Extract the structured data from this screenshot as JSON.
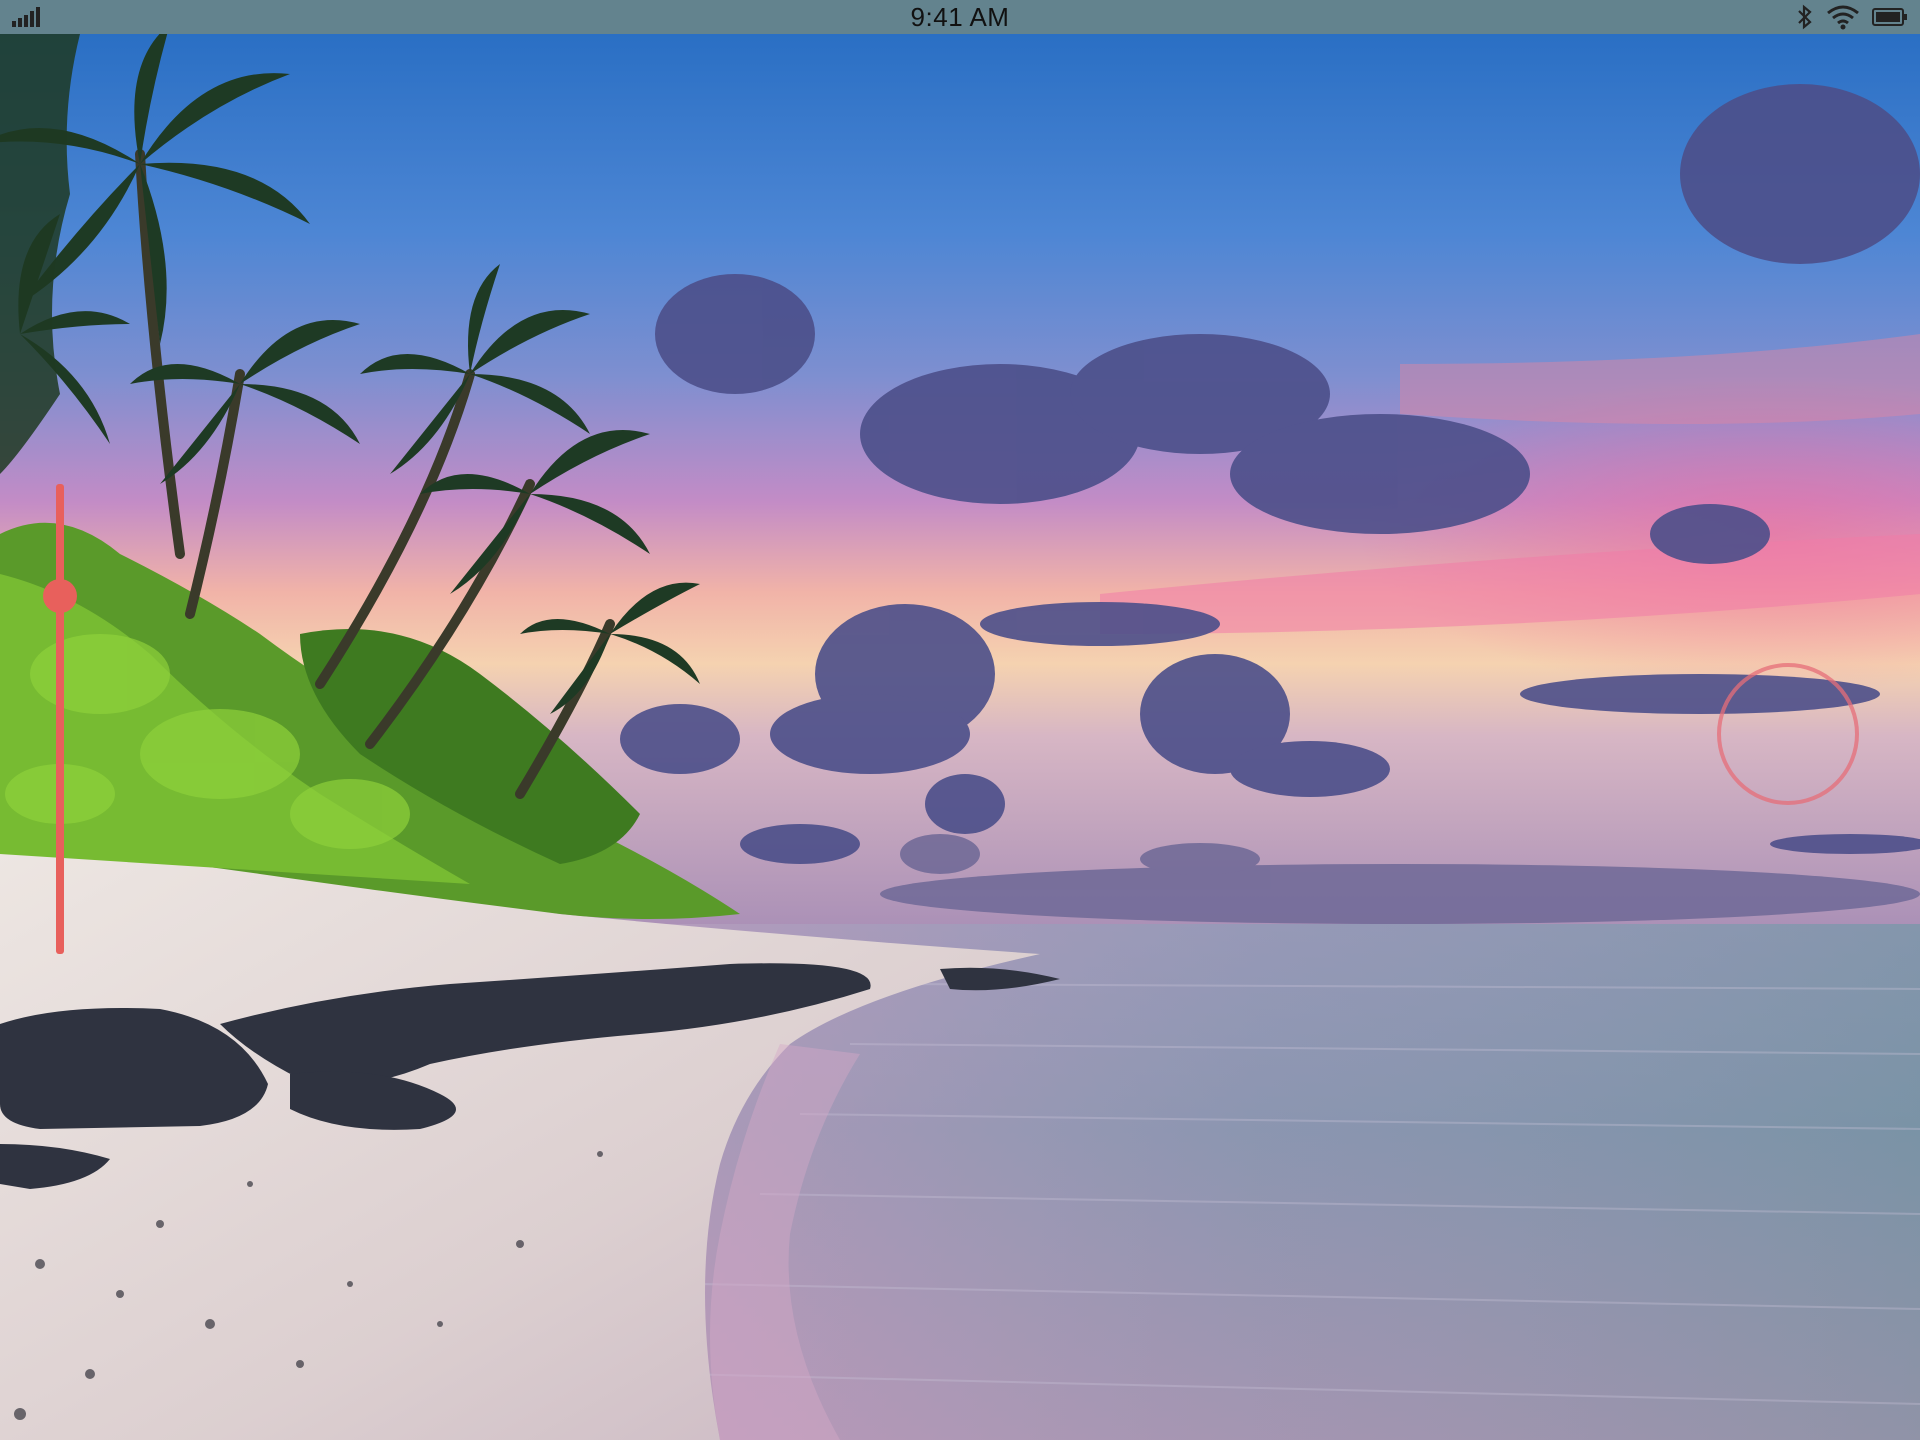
{
  "status_bar": {
    "time": "9:41 AM",
    "icons": [
      "signal-bars-icon",
      "bluetooth-icon",
      "wifi-icon",
      "battery-icon"
    ]
  },
  "photo": {
    "subject": "beach-sunset-photo"
  },
  "brightness_slider": {
    "value": 0.75
  },
  "colors": {
    "status_bar_bg": "#63838e",
    "accent": "#e8605c",
    "focus_ring": "#e66e78"
  }
}
